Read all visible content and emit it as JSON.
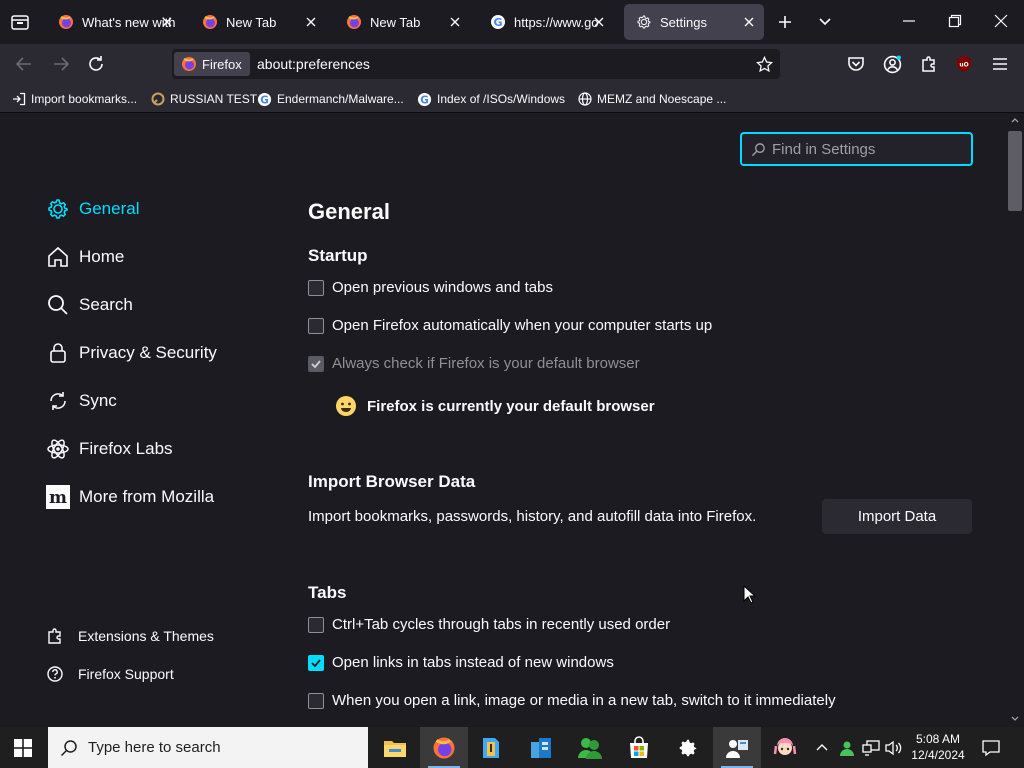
{
  "tabs": [
    {
      "title": "What's new with",
      "icon": "firefox-icon"
    },
    {
      "title": "New Tab",
      "icon": "firefox-icon"
    },
    {
      "title": "New Tab",
      "icon": "firefox-icon"
    },
    {
      "title": "https://www.goo",
      "icon": "google-icon"
    },
    {
      "title": "Settings",
      "icon": "gear-icon",
      "active": true
    }
  ],
  "urlbar": {
    "identity_label": "Firefox",
    "url": "about:preferences"
  },
  "bookmarks": [
    {
      "label": "Import bookmarks...",
      "icon": "import-icon"
    },
    {
      "label": "RUSSIAN TEST",
      "icon": "bookmark-favicon"
    },
    {
      "label": "Endermanch/Malware...",
      "icon": "google-icon"
    },
    {
      "label": "Index of /ISOs/Windows",
      "icon": "google-icon"
    },
    {
      "label": "MEMZ and Noescape ...",
      "icon": "globe-icon"
    }
  ],
  "search": {
    "placeholder": "Find in Settings"
  },
  "categories": [
    {
      "label": "General",
      "icon": "gear-icon",
      "selected": true
    },
    {
      "label": "Home",
      "icon": "home-icon"
    },
    {
      "label": "Search",
      "icon": "search-icon"
    },
    {
      "label": "Privacy & Security",
      "icon": "lock-icon"
    },
    {
      "label": "Sync",
      "icon": "sync-icon"
    },
    {
      "label": "Firefox Labs",
      "icon": "labs-icon"
    },
    {
      "label": "More from Mozilla",
      "icon": "mozilla-icon"
    }
  ],
  "footer_links": [
    {
      "label": "Extensions & Themes",
      "icon": "puzzle-icon"
    },
    {
      "label": "Firefox Support",
      "icon": "help-icon"
    }
  ],
  "general": {
    "title": "General",
    "startup": {
      "heading": "Startup",
      "options": [
        {
          "label": "Open previous windows and tabs",
          "checked": false
        },
        {
          "label": "Open Firefox automatically when your computer starts up",
          "checked": false
        },
        {
          "label": "Always check if Firefox is your default browser",
          "checked": true,
          "disabled": true
        }
      ],
      "default_status": "Firefox is currently your default browser"
    },
    "import": {
      "heading": "Import Browser Data",
      "description": "Import bookmarks, passwords, history, and autofill data into Firefox.",
      "button": "Import Data"
    },
    "tabs": {
      "heading": "Tabs",
      "options": [
        {
          "label": "Ctrl+Tab cycles through tabs in recently used order",
          "checked": false
        },
        {
          "label": "Open links in tabs instead of new windows",
          "checked": true
        },
        {
          "label": "When you open a link, image or media in a new tab, switch to it immediately",
          "checked": false
        }
      ]
    }
  },
  "taskbar": {
    "search_placeholder": "Type here to search",
    "time": "5:08 AM",
    "date": "12/4/2024"
  },
  "colors": {
    "accent": "#00ddff",
    "background": "#1c1b22",
    "toolbar": "#2b2a33"
  }
}
